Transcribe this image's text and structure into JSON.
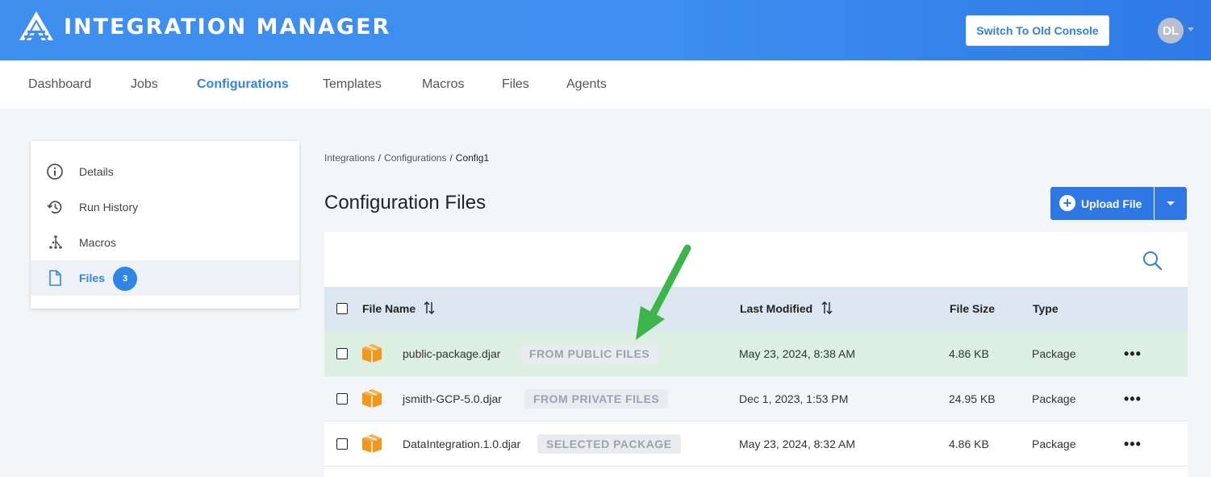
{
  "header": {
    "app_title": "INTEGRATION MANAGER",
    "switch_button": "Switch To Old Console",
    "avatar_initials": "DL"
  },
  "nav": {
    "tabs": [
      {
        "label": "Dashboard",
        "active": false
      },
      {
        "label": "Jobs",
        "active": false
      },
      {
        "label": "Configurations",
        "active": true
      },
      {
        "label": "Templates",
        "active": false
      },
      {
        "label": "Macros",
        "active": false
      },
      {
        "label": "Files",
        "active": false
      },
      {
        "label": "Agents",
        "active": false
      }
    ]
  },
  "sidebar": {
    "items": [
      {
        "label": "Details",
        "icon": "info-icon"
      },
      {
        "label": "Run History",
        "icon": "history-icon"
      },
      {
        "label": "Macros",
        "icon": "macros-icon"
      },
      {
        "label": "Files",
        "icon": "file-icon",
        "badge": "3",
        "active": true
      }
    ]
  },
  "breadcrumb": {
    "items": [
      "Integrations",
      "Configurations",
      "Config1"
    ]
  },
  "main": {
    "title": "Configuration Files",
    "upload_label": "Upload File"
  },
  "table": {
    "headers": {
      "file_name": "File Name",
      "last_modified": "Last Modified",
      "file_size": "File Size",
      "type": "Type"
    },
    "rows": [
      {
        "name": "public-package.djar",
        "tag": "FROM PUBLIC FILES",
        "modified": "May 23, 2024, 8:38 AM",
        "size": "4.86 KB",
        "type": "Package",
        "highlight": true
      },
      {
        "name": "jsmith-GCP-5.0.djar",
        "tag": "FROM PRIVATE FILES",
        "modified": "Dec 1, 2023, 1:53 PM",
        "size": "24.95 KB",
        "type": "Package",
        "highlight": false
      },
      {
        "name": "DataIntegration.1.0.djar",
        "tag": "SELECTED PACKAGE",
        "modified": "May 23, 2024, 8:32 AM",
        "size": "4.86 KB",
        "type": "Package",
        "highlight": false
      }
    ],
    "more_glyph": "•••"
  },
  "colors": {
    "accent": "#2f86e6",
    "highlight_row": "#dcefe0",
    "alt_row": "#f3f6f9",
    "arrow": "#3cb54a",
    "package_orange": "#f2961e"
  }
}
